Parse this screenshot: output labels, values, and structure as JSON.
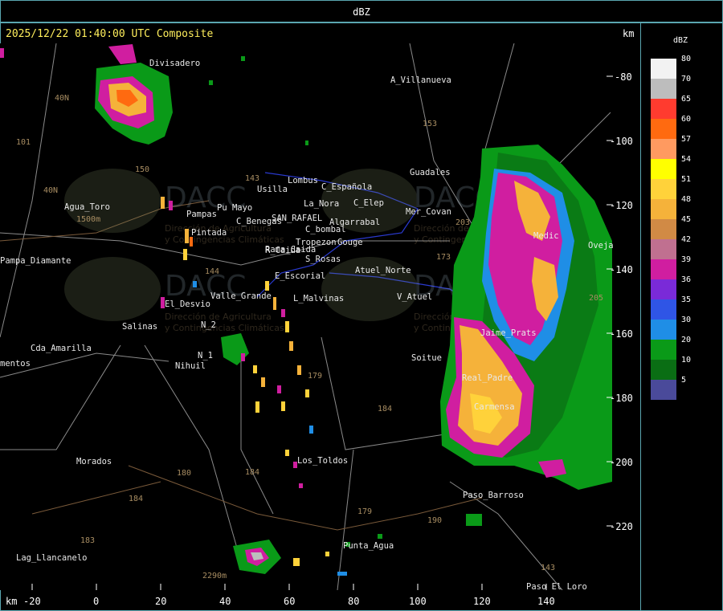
{
  "header": {
    "title": "dBZ"
  },
  "map": {
    "timestamp": "2025/12/22 01:40:00 UTC Composite",
    "km_label_top": "km",
    "km_label_bottom": "km",
    "y_axis_ticks": [
      "-80",
      "-100",
      "-120",
      "-140",
      "-160",
      "-180",
      "-200",
      "-220"
    ],
    "x_axis_ticks": [
      "-20",
      "0",
      "20",
      "40",
      "60",
      "80",
      "100",
      "120",
      "140"
    ],
    "places": [
      "Divisadero",
      "A_Villanueva",
      "Guadales",
      "Agua_Toro",
      "Pampa_Diamante",
      "Lombus",
      "Usilla",
      "C_Española",
      "La_Nora",
      "C_Elep",
      "Rama_Caida",
      "C_Benegas",
      "SAN_RAFAEL",
      "Algarrabal",
      "C_bombal",
      "Pintada",
      "Pampas",
      "S_Rosas",
      "Tropezon",
      "Gouge",
      "El_Desvio",
      "Valle_Grande",
      "Salinas",
      "N_2",
      "N_1",
      "Nihuil",
      "Cda_Amarilla",
      "mentos",
      "Soitue",
      "V_Atuel",
      "Atuel_Norte",
      "Carmensa",
      "Paso_Barroso",
      "Paso_El_Loro",
      "Morados",
      "Los_Toldos",
      "Punta_Agua",
      "Lag_Llancanelo",
      "Ovejas",
      "E_Escorial",
      "L_Malvinas",
      "Mer_Covan",
      "Real_Padre",
      "Jaime_Prats",
      "Medic",
      "R_Caida",
      "Pu Mayo"
    ],
    "route_numbers": [
      "40N",
      "40N",
      "101",
      "150",
      "153",
      "143",
      "144",
      "173",
      "203",
      "205",
      "184",
      "180",
      "184",
      "183",
      "184",
      "179",
      "190",
      "143",
      "179",
      "2290m",
      "1500m"
    ],
    "watermark": {
      "logo": "DACC",
      "line1": "Dirección de Agricultura",
      "line2": "y Contingencias Climáticas"
    }
  },
  "legend": {
    "title": "dBZ",
    "items": [
      {
        "label": "80",
        "color": "#f2f2f2"
      },
      {
        "label": "70",
        "color": "#bdbdbd"
      },
      {
        "label": "65",
        "color": "#ff3b2f"
      },
      {
        "label": "60",
        "color": "#ff6a10"
      },
      {
        "label": "57",
        "color": "#ff9a60"
      },
      {
        "label": "54",
        "color": "#ffff00"
      },
      {
        "label": "51",
        "color": "#ffd23a"
      },
      {
        "label": "48",
        "color": "#f5b23a"
      },
      {
        "label": "45",
        "color": "#d18a45"
      },
      {
        "label": "42",
        "color": "#c07090"
      },
      {
        "label": "39",
        "color": "#d01ea0"
      },
      {
        "label": "36",
        "color": "#7a2ad8"
      },
      {
        "label": "35",
        "color": "#2f55e6"
      },
      {
        "label": "30",
        "color": "#1f8ee6"
      },
      {
        "label": "20",
        "color": "#0a9a18"
      },
      {
        "label": "10",
        "color": "#0a6e14"
      },
      {
        "label": "5",
        "color": "#4a4a9a"
      }
    ]
  }
}
